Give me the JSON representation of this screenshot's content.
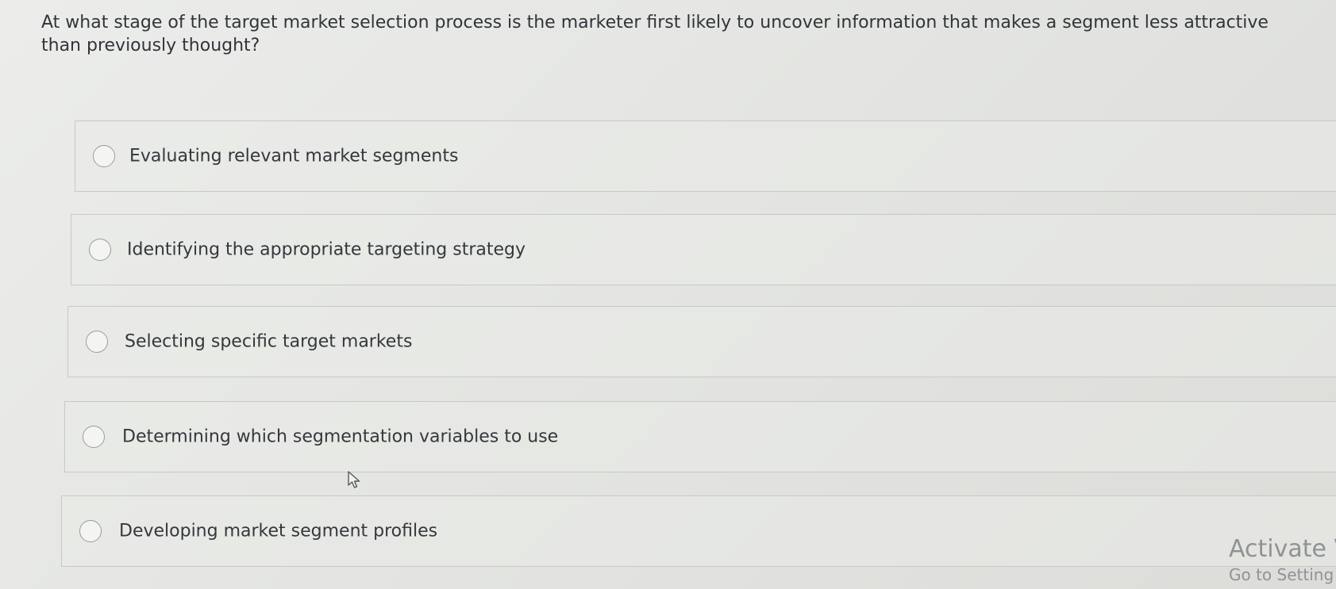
{
  "question": {
    "text": "At what stage of the target market selection process is the marketer first likely to uncover information that makes a segment less attractive than previously thought?"
  },
  "options": [
    {
      "label": "Evaluating relevant market segments"
    },
    {
      "label": "Identifying the appropriate targeting strategy"
    },
    {
      "label": "Selecting specific target markets"
    },
    {
      "label": "Determining which segmentation variables to use"
    },
    {
      "label": "Developing market segment profiles"
    }
  ],
  "watermark": {
    "line1": "Activate V",
    "line2": "Go to Setting"
  },
  "colors": {
    "background": "#e6e7e4",
    "text": "#30353a",
    "border": "#c8c9c6",
    "watermark": "#8f9396"
  }
}
